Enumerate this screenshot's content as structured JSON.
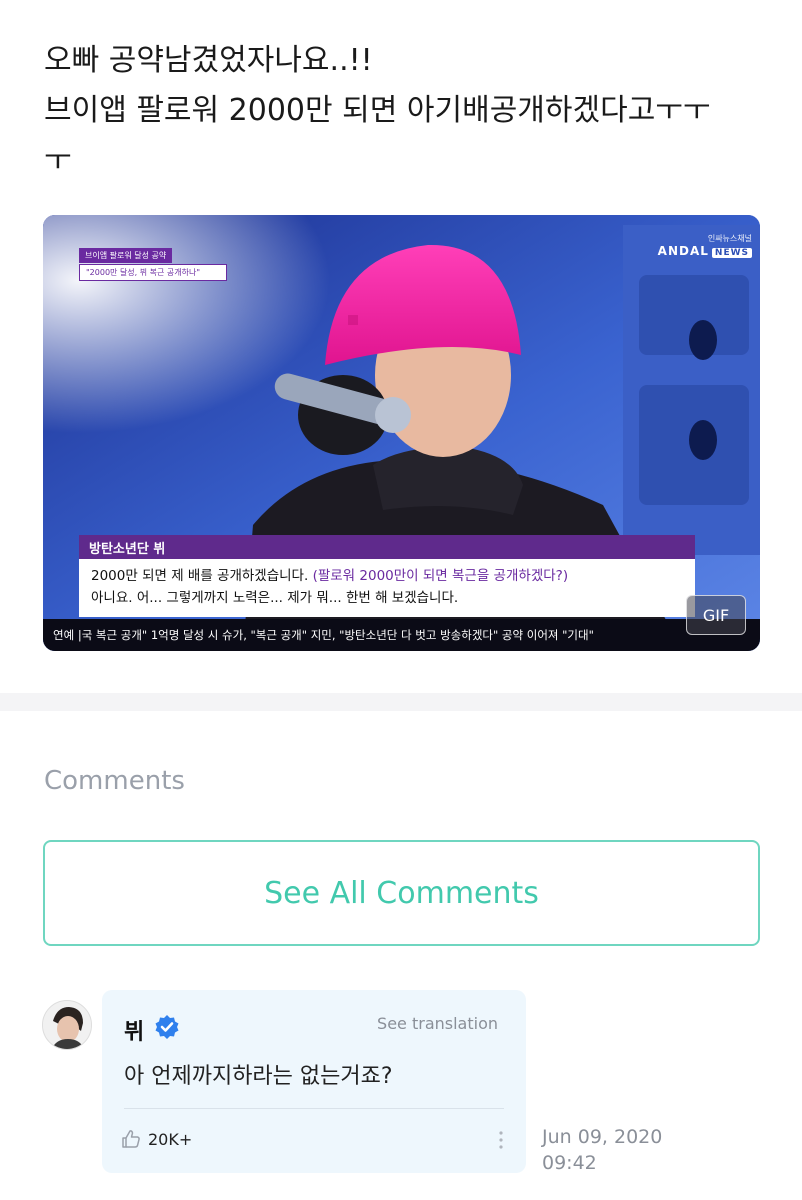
{
  "post": {
    "line1": "오빠 공약남겼었자나요..!!",
    "line2": "브이앱 팔로워 2000만 되면 아기배공개하겠다고ㅜㅜ",
    "line3": "ㅜ"
  },
  "media": {
    "badge_top": "브이앱 팔로워 달성 공약",
    "badge_bottom": "\"2000만 달성, 뷔 복근 공개하나\"",
    "brand_small": "인싸뉴스채널",
    "brand_main": "ANDAL",
    "brand_news": "NEWS",
    "speaker": "방탄소년단 뷔",
    "subtitle_1a": "2000만 되면 제 배를 공개하겠습니다.",
    "subtitle_1b": " (팔로워 2000만이 되면 복근을 공개하겠다?)",
    "subtitle_2": "아니요. 어... 그렇게까지 노력은... 제가 뭐... 한번 해 보겠습니다.",
    "ticker": "연예  |국 복근 공개\"  1억명 달성 시 슈가, \"복근 공개\" 지민, \"방탄소년단 다 벗고 방송하겠다\" 공약 이어져 \"기대\"",
    "gif_label": "GIF"
  },
  "comments": {
    "heading": "Comments",
    "see_all": "See All Comments"
  },
  "comment": {
    "author": "뷔",
    "see_translation": "See translation",
    "body": "아 언제까지하라는 없는거죠?",
    "likes": "20K+",
    "date": "Jun 09, 2020",
    "time": "09:42"
  },
  "icons": {
    "verified": "verified-badge-icon",
    "like": "thumbs-up-icon",
    "more": "more-vertical-icon"
  },
  "colors": {
    "accent": "#42c9ad",
    "verified": "#2f80ed",
    "bubble": "#eef7fd",
    "muted": "#8a8f98"
  }
}
